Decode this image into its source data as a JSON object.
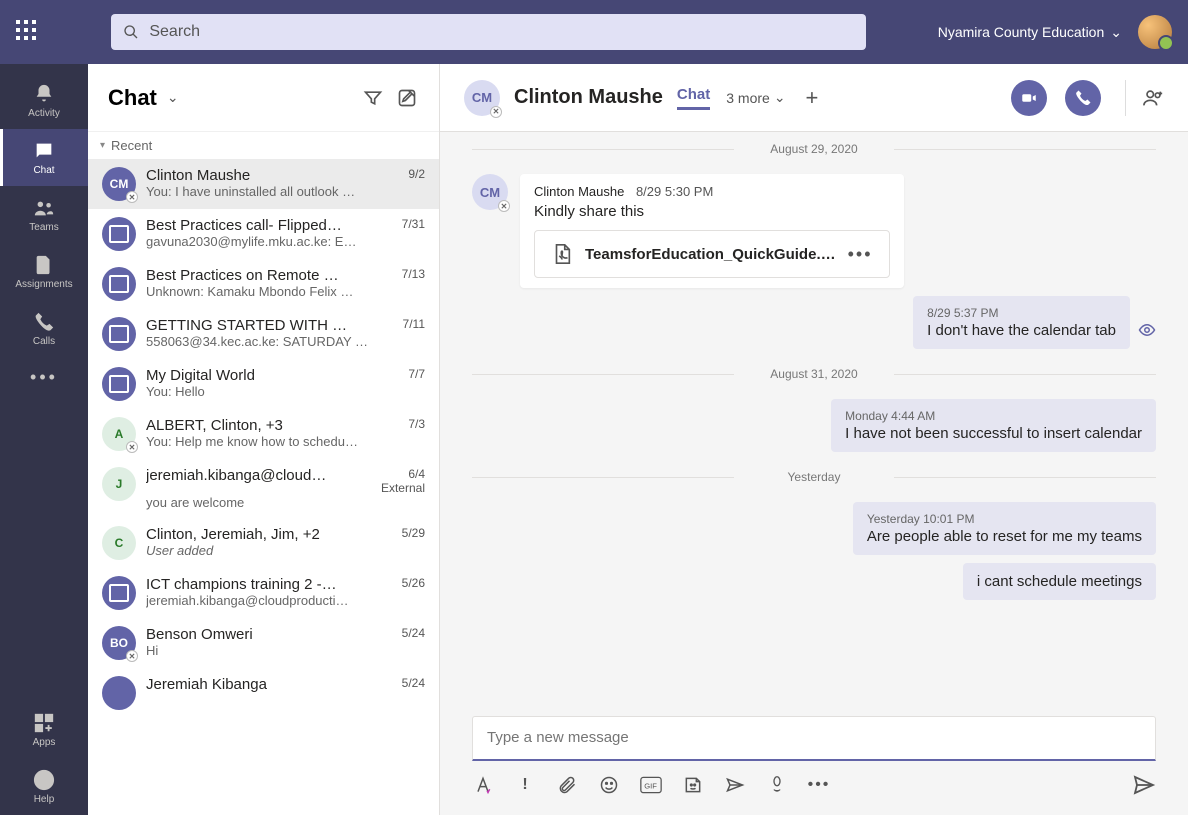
{
  "header": {
    "search_placeholder": "Search",
    "tenant": "Nyamira County Education"
  },
  "rail": {
    "activity": "Activity",
    "chat": "Chat",
    "teams": "Teams",
    "assignments": "Assignments",
    "calls": "Calls",
    "apps": "Apps",
    "help": "Help"
  },
  "chat_panel": {
    "title": "Chat",
    "section": "Recent",
    "items": [
      {
        "initials": "CM",
        "title": "Clinton Maushe",
        "date": "9/2",
        "preview": "You: I have uninstalled all outlook …",
        "selected": true,
        "avatar_type": "initials",
        "presence": "offline"
      },
      {
        "initials": "",
        "title": "Best Practices call- Flipped…",
        "date": "7/31",
        "preview": "gavuna2030@mylife.mku.ac.ke: E…",
        "avatar_type": "cal"
      },
      {
        "initials": "",
        "title": "Best Practices on Remote …",
        "date": "7/13",
        "preview": "Unknown: Kamaku Mbondo Felix …",
        "avatar_type": "cal"
      },
      {
        "initials": "",
        "title": "GETTING STARTED WITH …",
        "date": "7/11",
        "preview": "558063@34.kec.ac.ke: SATURDAY …",
        "avatar_type": "cal"
      },
      {
        "initials": "",
        "title": "My Digital World",
        "date": "7/7",
        "preview": "You: Hello",
        "avatar_type": "cal"
      },
      {
        "initials": "A",
        "title": "ALBERT, Clinton, +3",
        "date": "7/3",
        "preview": "You: Help me know how to schedu…",
        "avatar_type": "grp",
        "presence": "offline"
      },
      {
        "initials": "J",
        "title": "jeremiah.kibanga@cloud…",
        "date": "6/4",
        "preview": "you are welcome",
        "avatar_type": "grp",
        "badge": "External"
      },
      {
        "initials": "C",
        "title": "Clinton, Jeremiah, Jim, +2",
        "date": "5/29",
        "preview": "User added",
        "avatar_type": "grp",
        "italic": true
      },
      {
        "initials": "",
        "title": "ICT champions training 2 -…",
        "date": "5/26",
        "preview": "jeremiah.kibanga@cloudproducti…",
        "avatar_type": "cal"
      },
      {
        "initials": "BO",
        "title": "Benson Omweri",
        "date": "5/24",
        "preview": "Hi",
        "avatar_type": "initials",
        "presence": "offline"
      },
      {
        "initials": "",
        "title": "Jeremiah Kibanga",
        "date": "5/24",
        "preview": "",
        "avatar_type": "initials"
      }
    ]
  },
  "convo": {
    "avatar_initials": "CM",
    "title": "Clinton Maushe",
    "tab_chat": "Chat",
    "more_tabs": "3 more",
    "dates": {
      "d0": "August 29, 2020",
      "d1": "August 31, 2020",
      "d2": "Yesterday"
    },
    "msg1": {
      "sender": "Clinton Maushe",
      "time": "8/29 5:30 PM",
      "text": "Kindly share this",
      "attachment": "TeamsforEducation_QuickGuide.…"
    },
    "msg2": {
      "time": "8/29 5:37 PM",
      "text": "I don't have the calendar tab"
    },
    "msg3": {
      "time": "Monday 4:44 AM",
      "text": "I have not been successful to insert calendar"
    },
    "msg4": {
      "time": "Yesterday 10:01 PM",
      "text": "Are people able to reset for me my teams"
    },
    "msg5": {
      "text": "i cant schedule meetings"
    },
    "compose_placeholder": "Type a new message"
  }
}
